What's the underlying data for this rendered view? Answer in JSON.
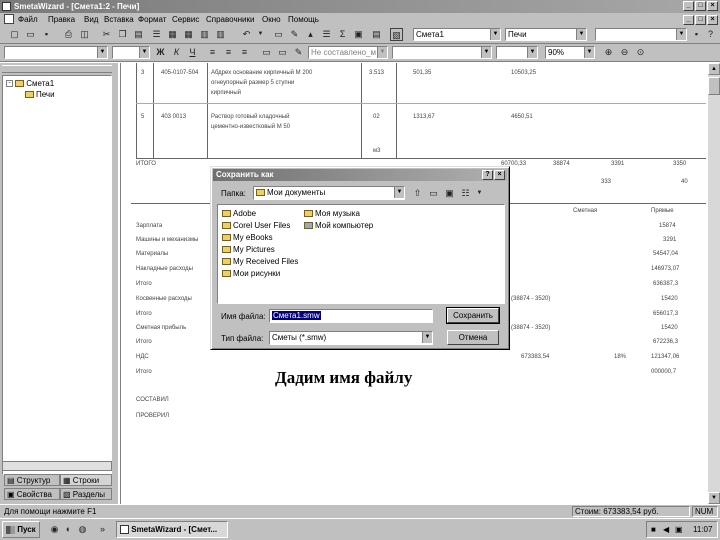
{
  "window": {
    "title": "SmetaWizard - [Смета1:2 - Печи]"
  },
  "menu": [
    "Файл",
    "Правка",
    "Вид",
    "Вставка",
    "Формат",
    "Сервис",
    "Справочники",
    "Окно",
    "Помощь"
  ],
  "toolbar": {
    "combo_smeta": "Смета1",
    "combo_section": "Печи",
    "combo_style": "Не составлено_м",
    "zoom": "90%"
  },
  "tree": {
    "root": "Смета1",
    "child": "Печи"
  },
  "left_tabs": {
    "tab1": "Структур",
    "tab2": "Строки",
    "tab3": "Свойства",
    "tab4": "Разделы"
  },
  "document": {
    "rows": [
      {
        "num": "3",
        "code": "405-0107-504",
        "desc1": "Абдрех основание кирпичный М 200",
        "desc2": "огнеупорный размер 5 ступни",
        "desc3": "кирпичный",
        "qty": "3.513",
        "price": "501,35",
        "total": "10503,25"
      },
      {
        "num": "5",
        "code": "403 0013",
        "desc1": "Раствор готовый кладочный",
        "desc2": "цементно-известковый М 50",
        "qty": "02",
        "price": "1313,67",
        "total": "4650,51",
        "unit": "м3"
      }
    ],
    "itogo_label": "ИТОГО",
    "itogo_vals": [
      "60700,33",
      "38874",
      "3391",
      "3350"
    ],
    "itogo_sub": [
      "333",
      "40"
    ],
    "hdr_cols": [
      "Сметная",
      "Прямые"
    ],
    "left_labels": [
      "Зарплата",
      "Машины и механизмы",
      "Материалы",
      "Накладные расходы",
      "Итого",
      "Косвенные расходы",
      "Итого",
      "Сметная прибыль",
      "Итого",
      "НДС",
      "Итого",
      "СОСТАВИЛ",
      "ПРОВЕРИЛ"
    ],
    "right_vals": [
      "15874",
      "3291",
      "54547,04",
      "146973,07",
      "636387,3",
      "15420",
      "656017,3",
      "15420",
      "672236,3",
      "121347,06",
      "000000,7"
    ],
    "mid_vals": [
      "(38874 - 3520)",
      "(38874 - 3520)"
    ],
    "nds_val": "673383,54",
    "nds_pct": "18%"
  },
  "dialog": {
    "title": "Сохранить как",
    "folder_label": "Папка:",
    "folder_value": "Мои документы",
    "files_col1": [
      "Adobe",
      "Corel User Files",
      "My eBooks",
      "My Pictures",
      "My Received Files",
      "Мои рисунки"
    ],
    "files_col2": [
      "Моя музыка",
      "Мой компьютер"
    ],
    "filename_label": "Имя файла:",
    "filename_value": "Смета1.smw",
    "filetype_label": "Тип файла:",
    "filetype_value": "Сметы (*.smw)",
    "save_button": "Сохранить",
    "cancel_button": "Отмена"
  },
  "caption": "Дадим имя файлу",
  "statusbar": {
    "left": "Для помощи нажмите F1",
    "right": "Стоим: 673383,54 руб.",
    "mode": "NUM"
  },
  "taskbar": {
    "start": "Пуск",
    "task": "SmetaWizard - [Смет...",
    "clock": "11:07"
  }
}
